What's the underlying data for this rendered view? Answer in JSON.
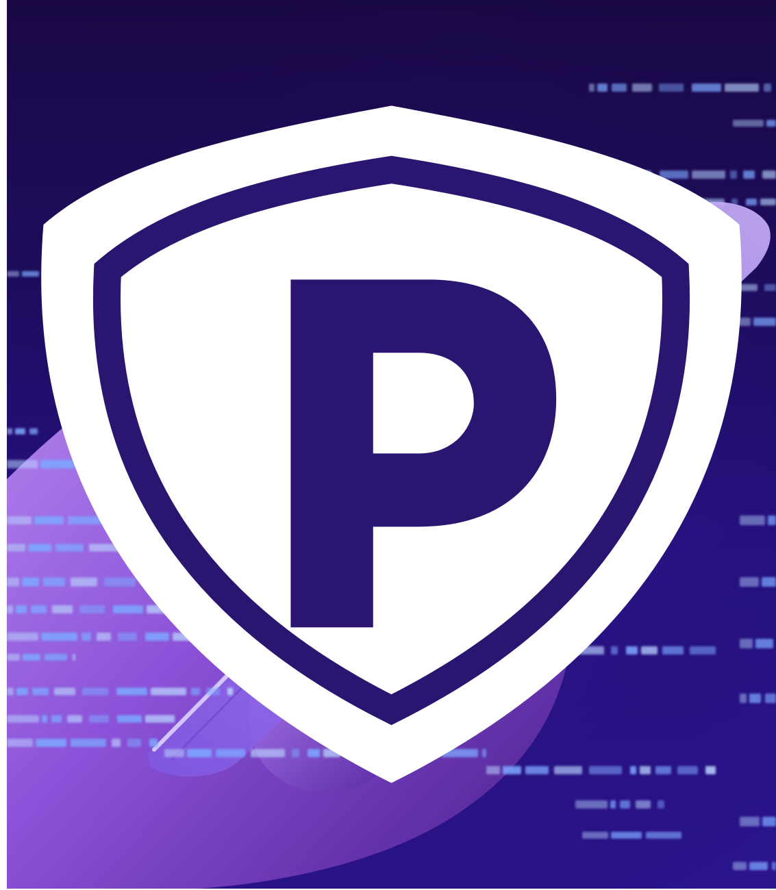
{
  "scene": {
    "subject": "hand-holding-phone",
    "overlay": "code-lines",
    "colors": {
      "background_dark": "#190845",
      "background_mid": "#261183",
      "code_glow": "#7da8ff",
      "code_core": "#b8d4ff",
      "hand_light": "#c29cf5",
      "hand_mid": "#8c52d9",
      "hand_dark": "#4a1f8c",
      "phone": "#a67ef2",
      "phone_edge": "#d7c6fb"
    }
  },
  "logo": {
    "icon": "shield-p-icon",
    "letter": "P",
    "colors": {
      "shield_fill": "#ffffff",
      "shield_outline": "#2a1670",
      "letter": "#2a1670"
    }
  }
}
